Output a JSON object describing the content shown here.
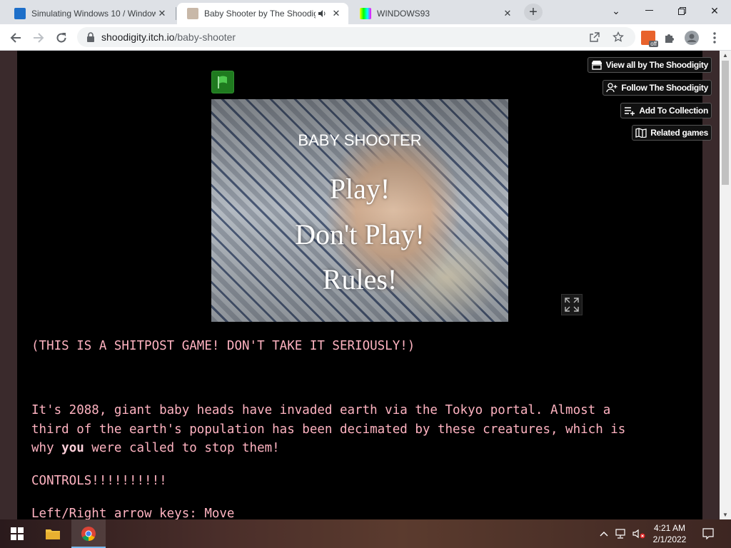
{
  "tabs": [
    {
      "title": "Simulating Windows 10 / Windows",
      "favicon": "simulating-windows-favicon",
      "active": false
    },
    {
      "title": "Baby Shooter by The Shoodigity",
      "favicon": "itch-game-favicon",
      "active": true,
      "audio": "speaker-icon"
    },
    {
      "title": "WINDOWS93",
      "favicon": "windows93-favicon",
      "active": false
    }
  ],
  "address_bar": {
    "url_host": "shoodigity.itch.io",
    "url_path": "/baby-shooter"
  },
  "toolbar": {
    "extension_badge": "off"
  },
  "sidebar_buttons": {
    "view_all": "View all by The Shoodigity",
    "follow": "Follow The Shoodigity",
    "add_collection": "Add To Collection",
    "related": "Related games"
  },
  "game": {
    "title": "BABY SHOOTER",
    "options": [
      "Play!",
      "Don't Play!",
      "Rules!"
    ]
  },
  "description": {
    "notice": "(THIS IS A SHITPOST GAME! DON'T TAKE IT SERIOUSLY!)",
    "story_line1": "It's 2088, giant baby heads have invaded earth via the Tokyo portal. Almost a",
    "story_line2": "third of the earth's population has been decimated by these creatures, which is",
    "story_line3_pre": "why ",
    "story_line3_bold": "you",
    "story_line3_post": " were called to stop them!",
    "controls_heading": "CONTROLS!!!!!!!!!!",
    "controls_line1": "Left/Right arrow keys: Move"
  },
  "taskbar": {
    "time": "4:21 AM",
    "date": "2/1/2022"
  },
  "colors": {
    "page_background": "#3a2a2c",
    "column_background": "#000000",
    "description_text": "#ffb3c1",
    "flag_green": "#1f7a1f"
  }
}
